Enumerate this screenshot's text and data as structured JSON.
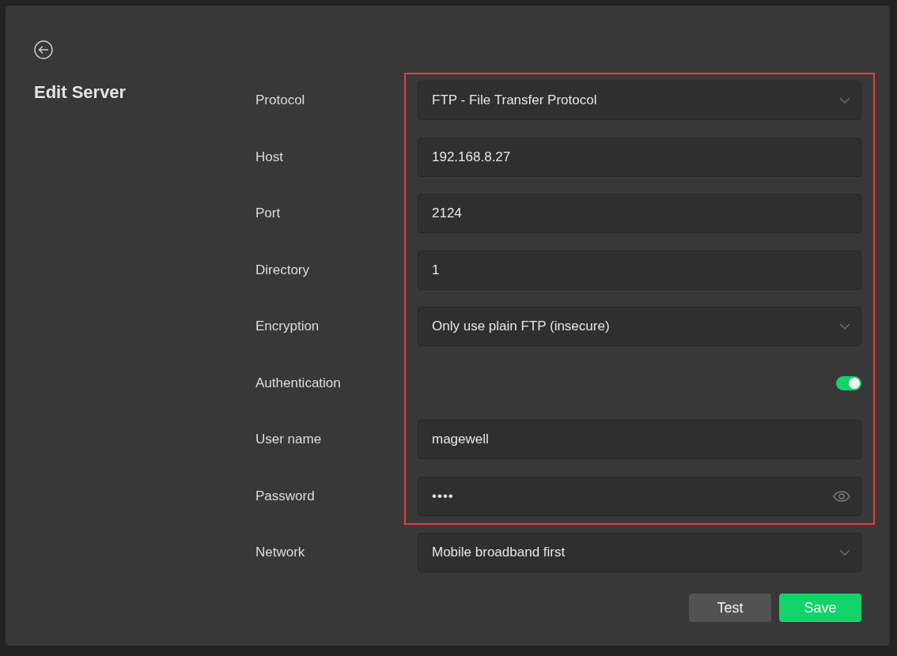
{
  "title": "Edit Server",
  "fields": [
    {
      "label": "Protocol",
      "kind": "select",
      "value": "FTP - File Transfer Protocol"
    },
    {
      "label": "Host",
      "kind": "text",
      "value": "192.168.8.27"
    },
    {
      "label": "Port",
      "kind": "text",
      "value": "2124"
    },
    {
      "label": "Directory",
      "kind": "text",
      "value": "1"
    },
    {
      "label": "Encryption",
      "kind": "select",
      "value": "Only use plain FTP (insecure)"
    },
    {
      "label": "Authentication",
      "kind": "toggle",
      "on": true
    },
    {
      "label": "User name",
      "kind": "text",
      "value": "magewell"
    },
    {
      "label": "Password",
      "kind": "password",
      "value": "••••"
    },
    {
      "label": "Network",
      "kind": "select",
      "value": "Mobile broadband first"
    }
  ],
  "buttons": [
    {
      "label": "Test",
      "kind": "secondary"
    },
    {
      "label": "Save",
      "kind": "primary"
    }
  ]
}
